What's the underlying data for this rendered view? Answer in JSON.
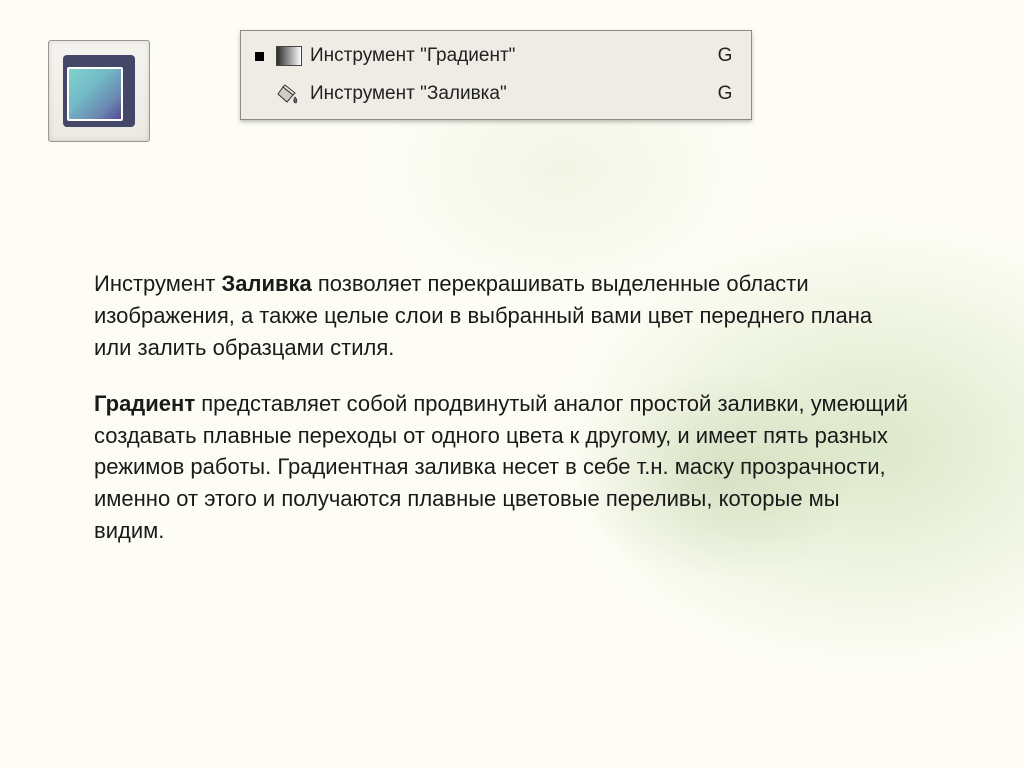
{
  "menu": {
    "items": [
      {
        "label": "Инструмент \"Градиент\"",
        "hotkey": "G",
        "selected": true
      },
      {
        "label": "Инструмент \"Заливка\"",
        "hotkey": "G",
        "selected": false
      }
    ]
  },
  "paragraphs": {
    "p1_lead": "Инструмент ",
    "p1_bold": "Заливка",
    "p1_rest": " позволяет перекрашивать выделенные области изображения, а также целые слои в выбранный вами цвет переднего плана или залить образцами стиля.",
    "p2_bold": "Градиент",
    "p2_rest": " представляет собой продвинутый аналог простой заливки, умеющий создавать плавные переходы от одного цвета к другому, и имеет пять разных режимов работы. Градиентная заливка несет в себе т.н. маску прозрачности, именно от этого и получаются плавные цветовые переливы, которые мы видим."
  }
}
